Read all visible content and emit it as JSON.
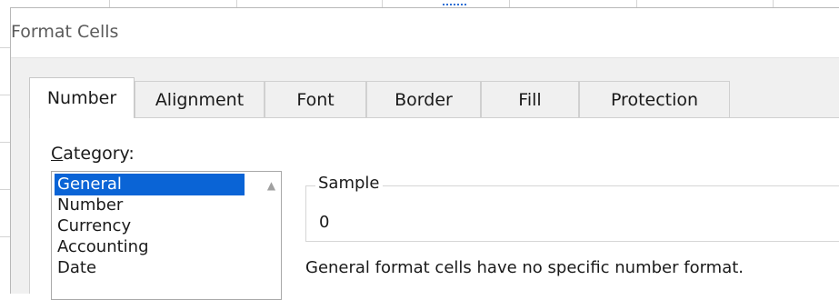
{
  "dialog": {
    "title": "Format Cells",
    "tabs": [
      {
        "label": "Number",
        "active": true
      },
      {
        "label": "Alignment",
        "active": false
      },
      {
        "label": "Font",
        "active": false
      },
      {
        "label": "Border",
        "active": false
      },
      {
        "label": "Fill",
        "active": false
      },
      {
        "label": "Protection",
        "active": false
      }
    ]
  },
  "category": {
    "label_first": "C",
    "label_rest": "ategory:",
    "items": [
      "General",
      "Number",
      "Currency",
      "Accounting",
      "Date"
    ],
    "selected": "General"
  },
  "sample": {
    "legend": "Sample",
    "value": "0"
  },
  "description": "General format cells have no specific number format.",
  "colors": {
    "selection": "#0a64d6",
    "dialog_bg": "#f0f0f0",
    "panel_bg": "#ffffff"
  },
  "icons": {
    "scroll_up": "chevron-up-icon"
  }
}
